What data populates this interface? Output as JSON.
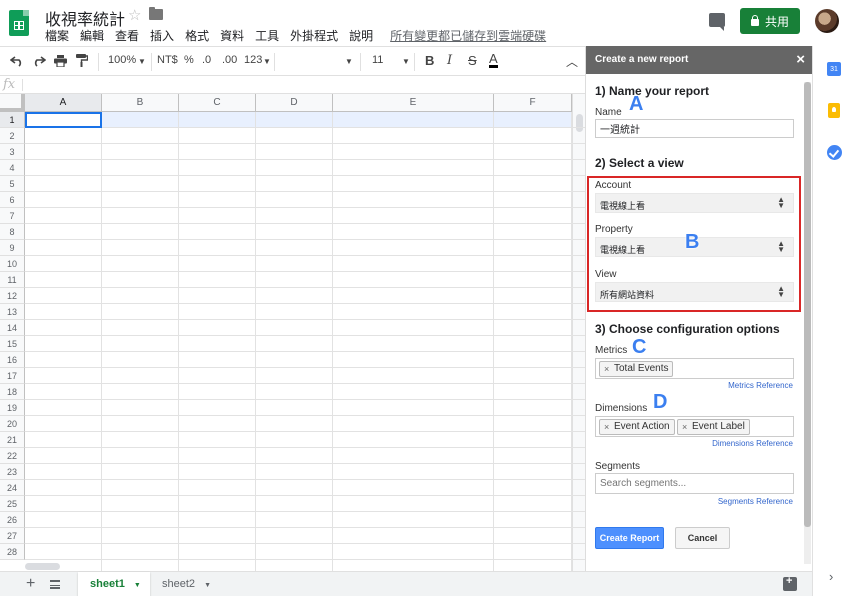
{
  "header": {
    "doc_title": "收視率統計",
    "menu": [
      "檔案",
      "編輯",
      "查看",
      "插入",
      "格式",
      "資料",
      "工具",
      "外掛程式",
      "說明"
    ],
    "saved_status": "所有變更都已儲存到雲端硬碟",
    "share_label": "共用"
  },
  "toolbar": {
    "zoom": "100%",
    "currency": "NT$",
    "percent": "%",
    "decimal_decrease": ".0",
    "decimal_increase": ".00",
    "number_format": "123",
    "font_size": "11",
    "bold": "B",
    "italic": "I",
    "strike": "S",
    "text_color": "A"
  },
  "formula_bar": {
    "fx": "fx"
  },
  "grid": {
    "columns": [
      "A",
      "B",
      "C",
      "D",
      "E",
      "F"
    ],
    "rows": [
      "1",
      "2",
      "3",
      "4",
      "5",
      "6",
      "7",
      "8",
      "9",
      "10",
      "11",
      "12",
      "13",
      "14",
      "15",
      "16",
      "17",
      "18",
      "19",
      "20",
      "21",
      "22",
      "23",
      "24",
      "25",
      "26",
      "27",
      "28"
    ]
  },
  "sheets": {
    "active": "sheet1",
    "inactive": "sheet2"
  },
  "panel": {
    "title": "Create a new report",
    "section1": "1) Name your report",
    "name_label": "Name",
    "name_value": "一週統計",
    "section2": "2) Select a view",
    "account_label": "Account",
    "account_value": "電視線上看",
    "property_label": "Property",
    "property_value": "電視線上看",
    "view_label": "View",
    "view_value": "所有網站資料",
    "section3": "3) Choose configuration options",
    "metrics_label": "Metrics",
    "metrics_chips": [
      "Total Events"
    ],
    "metrics_ref": "Metrics Reference",
    "dimensions_label": "Dimensions",
    "dimensions_chips": [
      "Event Action",
      "Event Label"
    ],
    "dimensions_ref": "Dimensions Reference",
    "segments_label": "Segments",
    "segments_placeholder": "Search segments...",
    "segments_ref": "Segments Reference",
    "create_label": "Create Report",
    "cancel_label": "Cancel"
  },
  "annotations": {
    "a": "A",
    "b": "B",
    "c": "C",
    "d": "D"
  },
  "colors": {
    "share_green": "#188038",
    "panel_header": "#666666",
    "highlight_red": "#d92626",
    "annotation_blue": "#3b7ff0",
    "primary_button": "#4d90fe"
  },
  "icons": {
    "header": [
      "sheets-logo-icon",
      "star-icon",
      "folder-icon",
      "comment-icon",
      "lock-icon",
      "avatar"
    ],
    "right_rail": [
      "calendar-icon",
      "keep-icon",
      "tasks-icon",
      "chevron-right-icon"
    ]
  }
}
